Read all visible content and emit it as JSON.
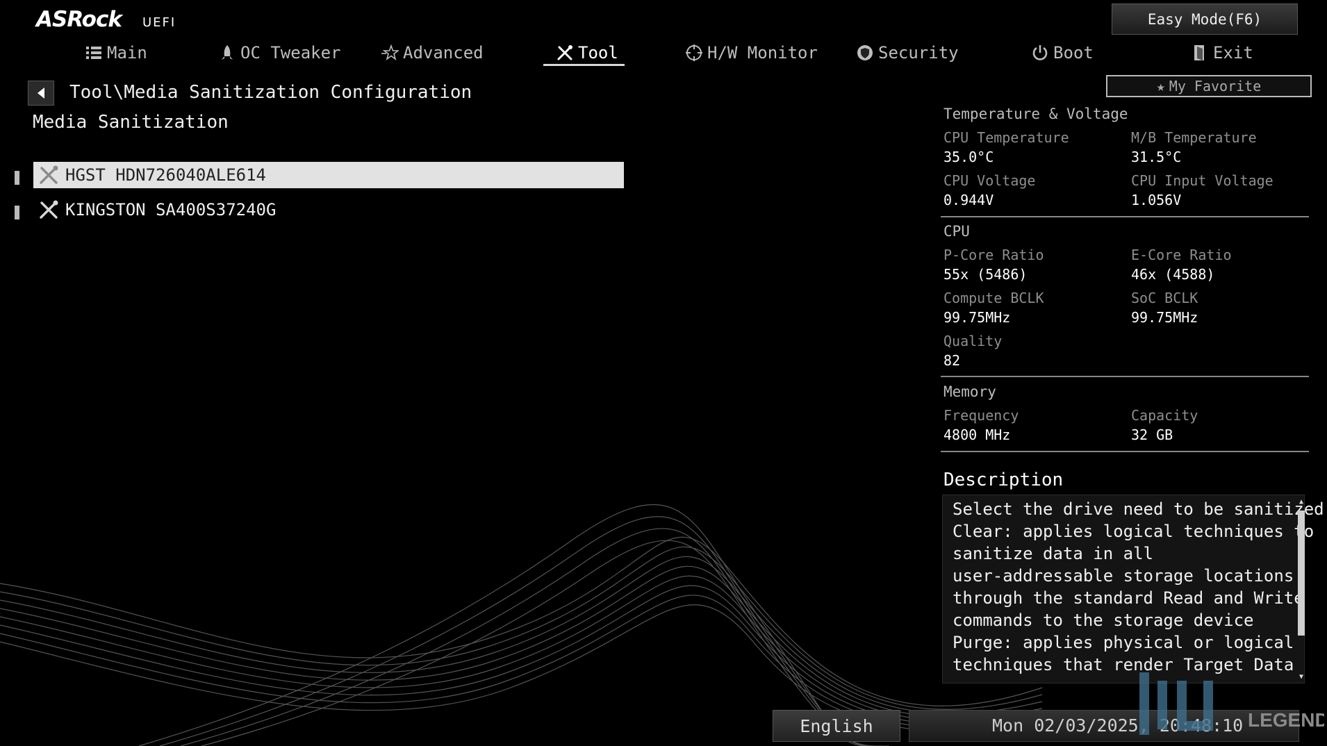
{
  "brand": {
    "name": "ASRock",
    "sub": "UEFI"
  },
  "easy_mode": "Easy Mode(F6)",
  "nav": [
    {
      "label": "Main",
      "icon": "list-icon"
    },
    {
      "label": "OC Tweaker",
      "icon": "rocket-icon"
    },
    {
      "label": "Advanced",
      "icon": "star-icon"
    },
    {
      "label": "Tool",
      "icon": "tools-icon",
      "active": true
    },
    {
      "label": "H/W Monitor",
      "icon": "crosshair-icon"
    },
    {
      "label": "Security",
      "icon": "shield-icon"
    },
    {
      "label": "Boot",
      "icon": "power-icon"
    },
    {
      "label": "Exit",
      "icon": "exit-icon"
    }
  ],
  "favorite": "My Favorite",
  "breadcrumb": "Tool\\Media Sanitization Configuration",
  "section_title": "Media Sanitization",
  "drives": [
    {
      "label": "HGST HDN726040ALE614",
      "selected": true
    },
    {
      "label": "KINGSTON SA400S37240G",
      "selected": false
    }
  ],
  "monitor": {
    "temp_title": "Temperature & Voltage",
    "cpu_temp_label": "CPU Temperature",
    "cpu_temp": "35.0°C",
    "mb_temp_label": "M/B Temperature",
    "mb_temp": "31.5°C",
    "cpu_volt_label": "CPU Voltage",
    "cpu_volt": "0.944V",
    "cpu_in_volt_label": "CPU Input Voltage",
    "cpu_in_volt": "1.056V",
    "cpu_title": "CPU",
    "pcore_label": "P-Core Ratio",
    "pcore": "55x (5486)",
    "ecore_label": "E-Core Ratio",
    "ecore": "46x (4588)",
    "cbclk_label": "Compute BCLK",
    "cbclk": "99.75MHz",
    "sbclk_label": "SoC BCLK",
    "sbclk": "99.75MHz",
    "quality_label": "Quality",
    "quality": "82",
    "mem_title": "Memory",
    "freq_label": "Frequency",
    "freq": "4800 MHz",
    "cap_label": "Capacity",
    "cap": "32 GB"
  },
  "description": {
    "title": "Description",
    "lines": [
      "Select the drive need to be sanitized",
      "Clear: applies logical techniques to",
      "sanitize data in all",
      "user-addressable storage locations",
      "through the standard Read and Write",
      "commands to the storage device",
      "Purge: applies physical or logical",
      "techniques that render Target Data"
    ]
  },
  "footer": {
    "language": "English",
    "datetime": "Mon 02/03/2025, 20:48:10"
  },
  "watermark": "LEGEND",
  "colors": {
    "background": "#000000",
    "selected_row": "#e2e2e2",
    "accent": "#ffffff"
  }
}
